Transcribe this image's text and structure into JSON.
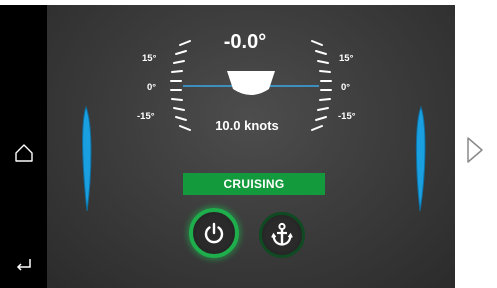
{
  "nav": {
    "home_icon": "home-icon",
    "back_icon": "back-arrow-icon",
    "next_icon": "chevron-right-icon"
  },
  "gauge": {
    "heel": "-0.0°",
    "speed": "10.0 knots",
    "left_ticks": [
      "15°",
      "0°",
      "-15°"
    ],
    "right_ticks": [
      "15°",
      "0°",
      "-15°"
    ]
  },
  "status": {
    "label": "CRUISING"
  },
  "controls": {
    "power_icon": "power-icon",
    "anchor_icon": "anchor-icon"
  },
  "colors": {
    "accent_green": "#139a3c",
    "power_ring": "#1fae4c",
    "anchor_ring": "#0f4a22",
    "tab_blue": "#1a9fe0",
    "horizon": "#3aa7e6"
  }
}
